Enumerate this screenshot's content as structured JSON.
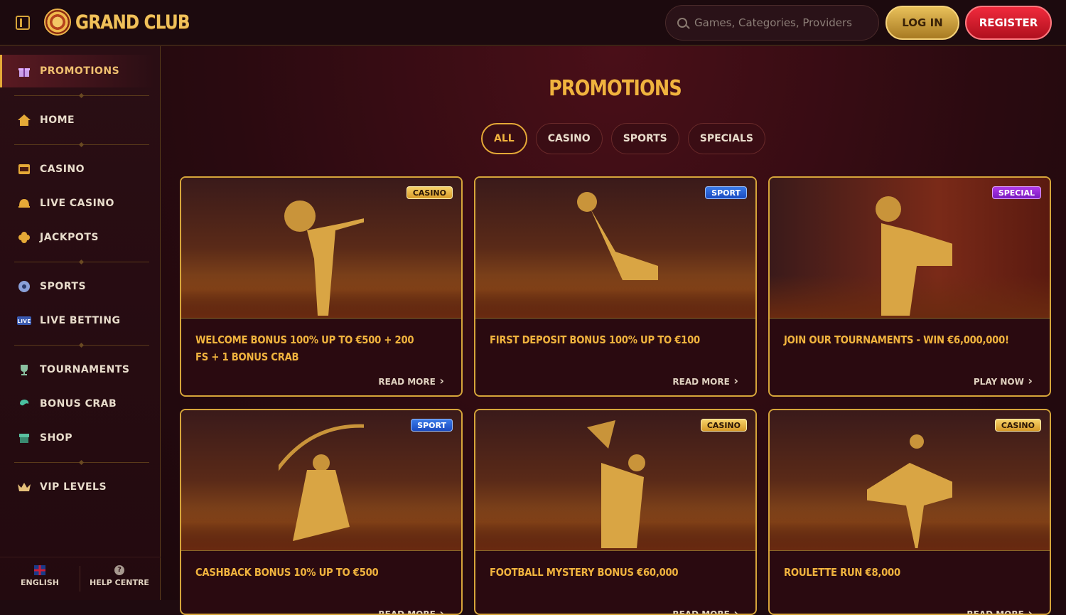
{
  "header": {
    "logo_text": "GRAND CLUB",
    "search_placeholder": "Games, Categories, Providers",
    "login_label": "LOG IN",
    "register_label": "REGISTER"
  },
  "sidebar": {
    "items": [
      {
        "label": "PROMOTIONS",
        "icon": "gift-icon"
      },
      {
        "label": "HOME",
        "icon": "home-icon"
      },
      {
        "label": "CASINO",
        "icon": "slot-machine-icon"
      },
      {
        "label": "LIVE CASINO",
        "icon": "bell-icon"
      },
      {
        "label": "JACKPOTS",
        "icon": "clover-icon"
      },
      {
        "label": "SPORTS",
        "icon": "soccer-ball-icon"
      },
      {
        "label": "LIVE BETTING",
        "icon": "live-icon"
      },
      {
        "label": "TOURNAMENTS",
        "icon": "trophy-icon"
      },
      {
        "label": "BONUS CRAB",
        "icon": "crab-icon"
      },
      {
        "label": "SHOP",
        "icon": "shop-icon"
      },
      {
        "label": "VIP LEVELS",
        "icon": "crown-icon"
      }
    ],
    "language_label": "ENGLISH",
    "help_label": "HELP CENTRE"
  },
  "main": {
    "title": "PROMOTIONS",
    "tabs": [
      "ALL",
      "CASINO",
      "SPORTS",
      "SPECIALS"
    ],
    "active_tab": "ALL",
    "cards": [
      {
        "badge": "CASINO",
        "title": "WELCOME BONUS 100% UP TO €500 + 200 FS + 1 BONUS CRAB",
        "link": "READ MORE"
      },
      {
        "badge": "SPORT",
        "title": "FIRST DEPOSIT BONUS 100% UP TO €100",
        "link": "READ MORE"
      },
      {
        "badge": "SPECIAL",
        "title": "JOIN OUR TOURNAMENTS - WIN €6,000,000!",
        "link": "PLAY NOW"
      },
      {
        "badge": "SPORT",
        "title": "CASHBACK BONUS 10% UP TO €500",
        "link": "READ MORE"
      },
      {
        "badge": "CASINO",
        "title": "FOOTBALL MYSTERY BONUS €60,000",
        "link": "READ MORE"
      },
      {
        "badge": "CASINO",
        "title": "ROULETTE RUN €8,000",
        "link": "READ MORE"
      }
    ]
  },
  "colors": {
    "accent": "#f0b33e",
    "register": "#e0202e",
    "background": "#2a0a10"
  }
}
